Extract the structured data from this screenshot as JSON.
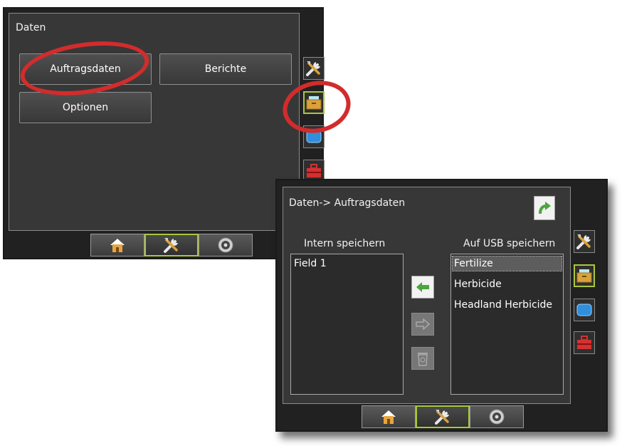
{
  "screen1": {
    "title": "Daten",
    "buttons": {
      "auftragsdaten": "Auftragsdaten",
      "berichte": "Berichte",
      "optionen": "Optionen"
    }
  },
  "screen2": {
    "title": "Daten-> Auftragsdaten",
    "left_header": "Intern speichern",
    "right_header": "Auf USB speichern",
    "internal_items": [
      "Field 1"
    ],
    "usb_items": [
      "Fertilize",
      "Herbicide",
      "Headland Herbicide"
    ],
    "selected_usb_item": "Fertilize"
  },
  "side_icons": [
    "tools-icon",
    "data-folder-icon",
    "display-icon",
    "toolbox-icon"
  ],
  "bottom_icons": [
    "home-icon",
    "tools-icon",
    "gauge-icon"
  ],
  "colors": {
    "screen_bg": "#212121",
    "panel_bg": "#373737",
    "active_border": "#a8c83c",
    "annotation_ring": "#d22c2c",
    "arrow_green": "#4aa63a"
  }
}
